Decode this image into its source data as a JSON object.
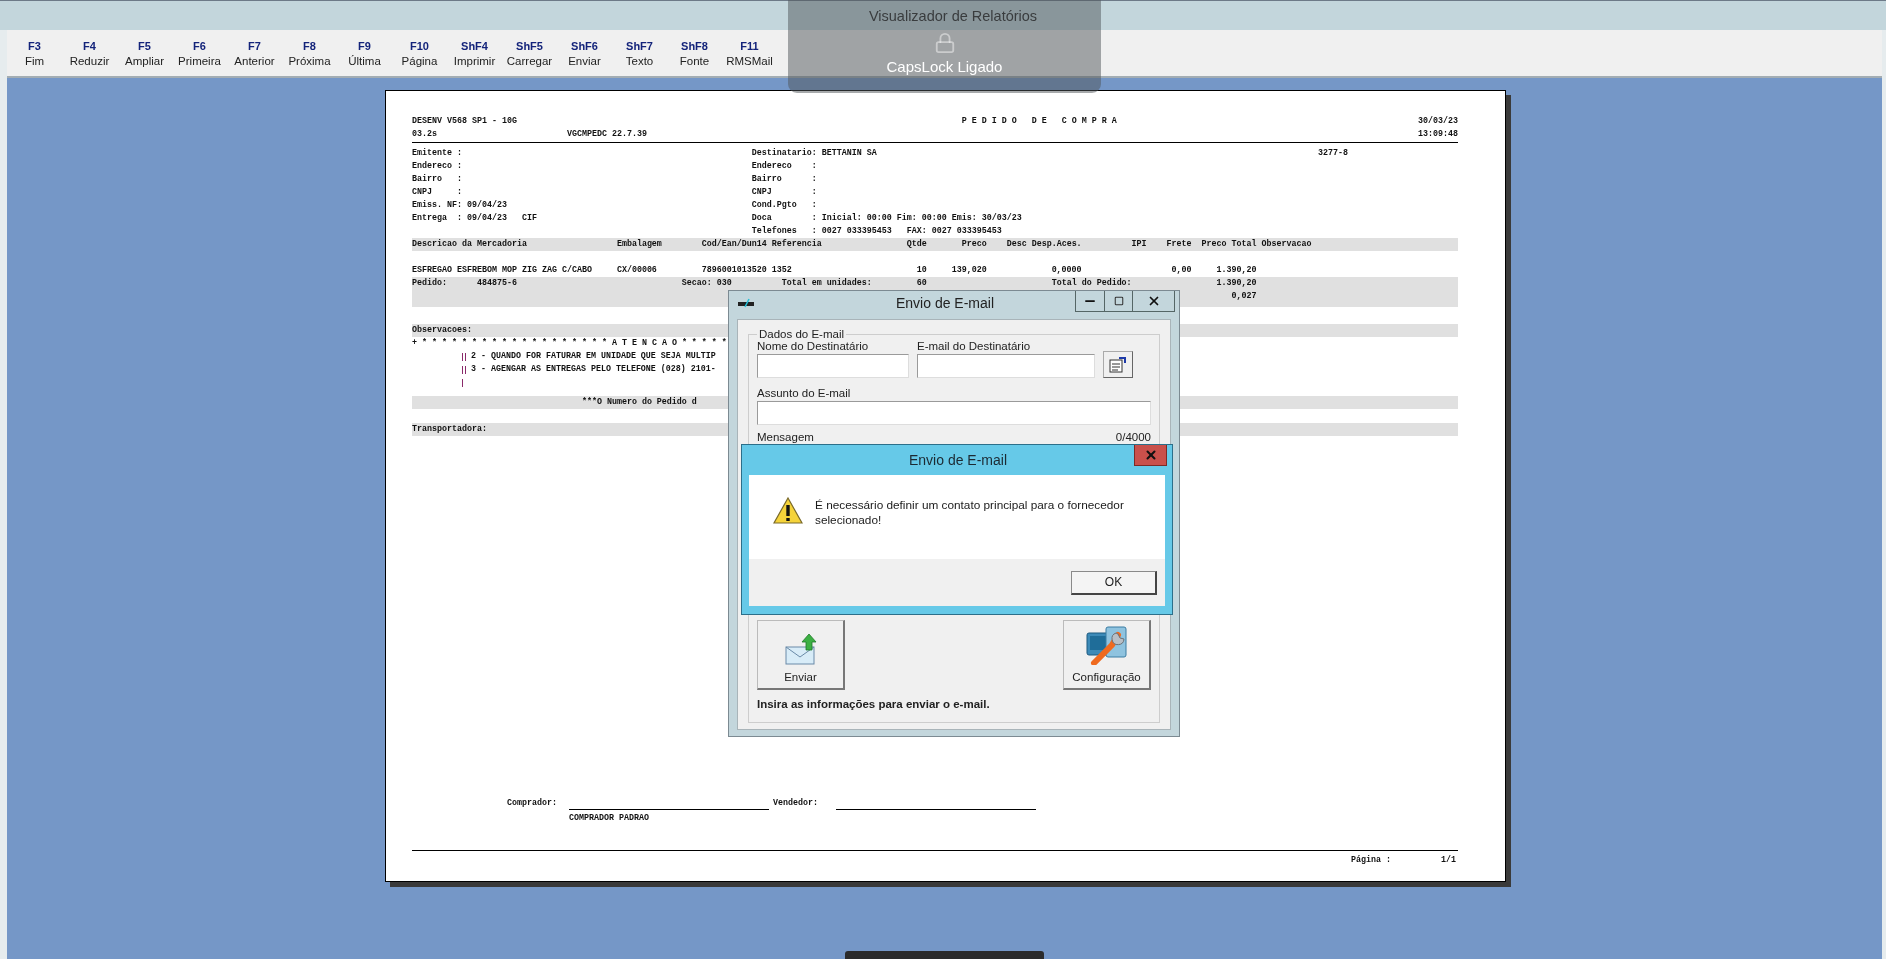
{
  "window": {
    "title": "Visualizador de Relatórios"
  },
  "caps_lock_notice": {
    "text": "CapsLock Ligado"
  },
  "toolbar": [
    {
      "key": "F3",
      "label": "Fim"
    },
    {
      "key": "F4",
      "label": "Reduzir"
    },
    {
      "key": "F5",
      "label": "Ampliar"
    },
    {
      "key": "F6",
      "label": "Primeira"
    },
    {
      "key": "F7",
      "label": "Anterior"
    },
    {
      "key": "F8",
      "label": "Próxima"
    },
    {
      "key": "F9",
      "label": "Última"
    },
    {
      "key": "F10",
      "label": "Página"
    },
    {
      "key": "ShF4",
      "label": "Imprimir"
    },
    {
      "key": "ShF5",
      "label": "Carregar"
    },
    {
      "key": "ShF6",
      "label": "Enviar"
    },
    {
      "key": "ShF7",
      "label": "Texto"
    },
    {
      "key": "ShF8",
      "label": "Fonte"
    },
    {
      "key": "F11",
      "label": "RMSMail"
    }
  ],
  "report": {
    "header": {
      "system": "DESENV V568 SP1 - 10G",
      "title": "P E D I D O   D E   C O M P R A",
      "date": "30/03/23",
      "elapsed": "03.2s",
      "program": "VGCMPEDC 22.7.39",
      "time": "13:09:48"
    },
    "issuer_fields": [
      {
        "label": "Emitente :"
      },
      {
        "label": "Endereco :"
      },
      {
        "label": "Bairro   :"
      },
      {
        "label": "CNPJ     :"
      },
      {
        "label": "Emiss. NF:",
        "values": [
          "09/04/23"
        ]
      },
      {
        "label": "Entrega  :",
        "values": [
          "09/04/23",
          "CIF"
        ]
      }
    ],
    "recipient_fields": [
      {
        "label": "Destinatario:",
        "values": [
          "BETTANIN SA"
        ],
        "code": "3277-8"
      },
      {
        "label": "Endereco    :"
      },
      {
        "label": "Bairro      :"
      },
      {
        "label": "CNPJ        :"
      },
      {
        "label": "Cond.Pgto   :"
      },
      {
        "label": "Doca        :",
        "values": [
          "Inicial: 00:00 Fim: 00:00 Emis: 30/03/23"
        ]
      },
      {
        "label": "Telefones   :",
        "values": [
          "0027 033395453",
          "FAX: 0027 033395453"
        ]
      }
    ],
    "table": {
      "columns": [
        "Descricao da Mercadoria",
        "Embalagem",
        "Cod/Ean/Dun14",
        "Referencia",
        "Qtde",
        "Preco",
        "Desc Desp.Aces.",
        "IPI",
        "Frete",
        "Preco Total",
        "Observacao"
      ],
      "rows": [
        {
          "description": "ESFREGAO ESFREBOM MOP ZIG ZAG C/CABO",
          "packaging": "CX/00006",
          "code": "7896001013520",
          "reference": "1352",
          "quantity": "10",
          "price": "139,020",
          "discount": "0,0000",
          "freight": "0,00",
          "total": "1.390,20"
        }
      ]
    },
    "summary": {
      "order_label": "Pedido:",
      "order_number": "484875-6",
      "section_label": "Secao:",
      "section": "030",
      "units_label": "Total em unidades:",
      "units": "60",
      "total_label": "Total do Pedido:",
      "total": "1.390,20",
      "extra_value": "0,027"
    },
    "observations": {
      "title": "Observacoes:",
      "banner": "+ * * * * * * * * * * * * * * * * * * * A T E N C A O * * * * *",
      "notes": [
        {
          "text": "2 - QUANDO FOR FATURAR EM UNIDADE QUE SEJA MULTIP"
        },
        {
          "text": "3 - AGENGAR AS ENTREGAS PELO TELEFONE (028) 2101-"
        }
      ],
      "trailing_bar": true
    },
    "notice": "***O Numero do Pedido d",
    "carrier_label": "Transportadora:",
    "signatures": {
      "buyer_label": "Comprador:",
      "buyer_name": "COMPRADOR PADRAO",
      "seller_label": "Vendedor:"
    },
    "footer": {
      "page_label": "Página :",
      "page": "1/1"
    }
  },
  "email_dialog": {
    "title": "Envio de E-mail",
    "group_label": "Dados do E-mail",
    "fields": [
      {
        "label": "Nome do Destinatário"
      },
      {
        "label": "E-mail do Destinatário"
      },
      {
        "label": "Assunto do E-mail"
      }
    ],
    "message_label": "Mensagem",
    "counter": "0/4000",
    "buttons": [
      {
        "label": "Enviar",
        "kind": "send"
      },
      {
        "label": "Configuração",
        "kind": "settings"
      }
    ],
    "status": "Insira as informações para enviar o e-mail."
  },
  "alert": {
    "title": "Envio de E-mail",
    "message": "É necessário definir um contato principal para o fornecedor selecionado!",
    "button": "OK"
  }
}
